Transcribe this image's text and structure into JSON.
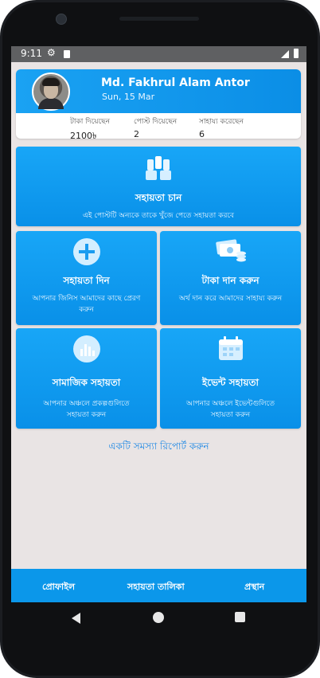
{
  "status_bar": {
    "time": "9:11"
  },
  "profile": {
    "name": "Md. Fakhrul Alam Antor",
    "date": "Sun, 15 Mar",
    "stats": [
      {
        "label": "টাকা দিয়েছেন",
        "value": "2100৳"
      },
      {
        "label": "পোস্ট দিয়েছেন",
        "value": "2"
      },
      {
        "label": "সাহায্য করেছেন",
        "value": "6"
      }
    ]
  },
  "cards": {
    "help_request": {
      "title": "সহায়তা চান",
      "desc": "এই পোস্টটি অন্যকে তাকে খুঁজে পেতে সহায়তা করবে"
    },
    "give_help": {
      "title": "সহায়তা দিন",
      "desc": "আপনার জিনিস আমাদের কাছে প্রেরণ করুন"
    },
    "donate_money": {
      "title": "টাকা দান করুন",
      "desc": "অর্থ দান করে আমাদের সাহায্য করুন"
    },
    "social_help": {
      "title": "সামাজিক সহায়তা",
      "desc": "আপনার অঞ্চলে প্রকল্পগুলিতে সহায়তা করুন"
    },
    "event_help": {
      "title": "ইভেন্ট সহায়তা",
      "desc": "আপনার অঞ্চলে ইভেন্টগুলিতে সহায়তা করুন"
    }
  },
  "report_link": "একটি সমস্যা রিপোর্ট করুন",
  "bottom_nav": {
    "profile": "প্রোফাইল",
    "help_list": "সহায়তা তালিকা",
    "logout": "প্রস্থান"
  },
  "icons": {
    "status": [
      "settings-icon",
      "sd-card-icon",
      "signal-icon",
      "battery-icon"
    ],
    "cards": [
      "raised-hands-icon",
      "plus-circle-icon",
      "money-coins-icon",
      "bar-chart-icon",
      "calendar-icon"
    ],
    "system_nav": [
      "back-icon",
      "home-icon",
      "recents-icon"
    ]
  },
  "colors": {
    "accent": "#0b97ea",
    "background": "#e9e4e4",
    "link": "#1e88e5"
  }
}
